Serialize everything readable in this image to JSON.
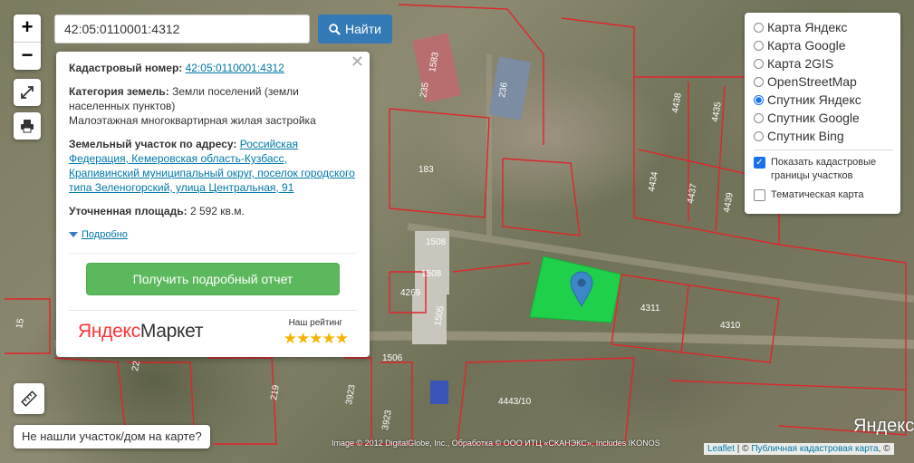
{
  "search": {
    "value": "42:05:0110001:4312",
    "button_label": "Найти"
  },
  "zoom": {
    "in_label": "+",
    "out_label": "−"
  },
  "popup": {
    "cadastral_label": "Кадастровый номер:",
    "cadastral_value": "42:05:0110001:4312",
    "category_label": "Категория земель:",
    "category_value": "Земли поселений (земли населенных пунктов)",
    "usage": "Малоэтажная многоквартирная жилая застройка",
    "address_label": "Земельный участок по адресу:",
    "address_value": "Российская Федерация, Кемеровская область-Кузбасс, Крапивинский муниципальный округ, поселок городского типа Зеленогорский, улица Центральная, 91",
    "area_label": "Уточненная площадь:",
    "area_value": "2 592 кв.м.",
    "more_label": "Подробно",
    "report_button": "Получить подробный отчет",
    "market_logo_y": "Яндекс",
    "market_logo_m": "Маркет",
    "rating_label": "Наш рейтинг",
    "stars": "★★★★★"
  },
  "layers": {
    "options": [
      {
        "label": "Карта Яндекс",
        "selected": false
      },
      {
        "label": "Карта Google",
        "selected": false
      },
      {
        "label": "Карта 2GIS",
        "selected": false
      },
      {
        "label": "OpenStreetMap",
        "selected": false
      },
      {
        "label": "Спутник Яндекс",
        "selected": true
      },
      {
        "label": "Спутник Google",
        "selected": false
      },
      {
        "label": "Спутник Bing",
        "selected": false
      }
    ],
    "show_borders_label": "Показать кадастровые границы участков",
    "show_borders_checked": true,
    "thematic_label": "Тематическая карта",
    "thematic_checked": false
  },
  "not_found_label": "Не нашли участок/дом на карте?",
  "attribution": {
    "leaflet": "Leaflet",
    "separator": " | © ",
    "pkk": "Публичная кадастровая карта",
    "tail": ", ©",
    "imagery": "Image © 2012 DigitalGlobe, Inc., Обработка © ООО ИТЦ «СКАНЭКС», Includes IKONOS"
  },
  "watermark": "Яндекс",
  "parcel_labels": [
    "1583",
    "235",
    "236",
    "183",
    "4438",
    "4435",
    "4434",
    "4437",
    "4439",
    "1508",
    "1508",
    "4269",
    "1505",
    "4311",
    "4310",
    "1506",
    "4443/10",
    "3923",
    "3923",
    "219",
    "15",
    "22"
  ],
  "accent_colors": {
    "parcel": "#1fd14a",
    "boundary": "#e0252b",
    "button_blue": "#337ab7",
    "button_green": "#5cb85c",
    "marker": "#3b87c8"
  }
}
